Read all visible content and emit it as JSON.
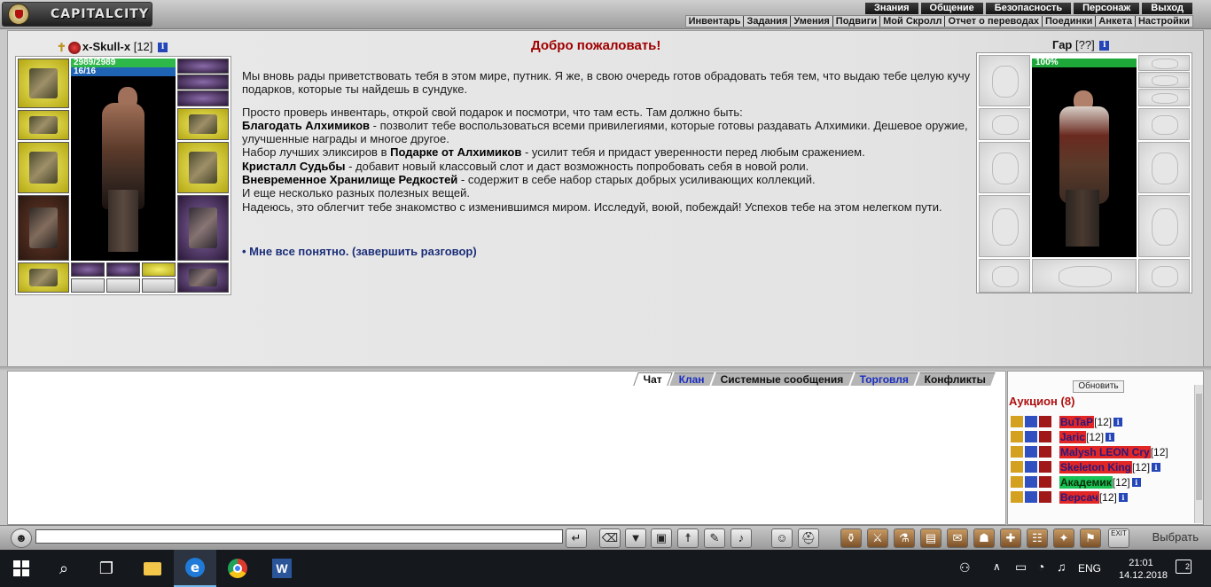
{
  "app": {
    "logo_text": "CAPITALCITY"
  },
  "top_nav": [
    "Знания",
    "Общение",
    "Безопасность",
    "Персонаж",
    "Выход"
  ],
  "sub_nav": [
    "Инвентарь",
    "Задания",
    "Умения",
    "Подвиги",
    "Мой Скролл",
    "Отчет о переводах",
    "Поединки",
    "Анкета",
    "Настройки"
  ],
  "player": {
    "name": "x-Skull-x",
    "level": "[12]",
    "hp": "2989/2989",
    "mana": "16/16"
  },
  "npc": {
    "name": "Гар",
    "level": "[??]",
    "hp": "100%"
  },
  "dialog": {
    "title": "Добро пожаловать!",
    "p1": "Мы вновь рады приветствовать тебя в этом мире, путник. Я же, в свою очередь готов обрадовать тебя тем, что выдаю тебе целую кучу подарков, которые ты найдешь в сундуке.",
    "p2": "Просто проверь инвентарь, открой свой подарок и посмотри, что там есть. Там должно быть:",
    "item1_bold": "Благодать Алхимиков",
    "item1_text": " - позволит тебе воспользоваться всеми привилегиями, которые готовы раздавать Алхимики. Дешевое оружие, улучшенные награды и многое другое.",
    "item2_pre": "Набор лучших эликсиров в ",
    "item2_bold": "Подарке от Алхимиков",
    "item2_text": " - усилит тебя и придаст уверенности перед любым сражением.",
    "item3_bold": "Кристалл Судьбы",
    "item3_text": " - добавит новый классовый слот и даст возможность попробовать себя в новой роли.",
    "item4_bold": "Вневременное Хранилище Редкостей",
    "item4_text": " - содержит в себе набор старых добрых усиливающих коллекций.",
    "item5_text": "И еще несколько разных полезных вещей.",
    "p3": "Надеюсь, это облегчит тебе знакомство с изменившимся миром. Исследуй, воюй, побеждай! Успехов тебе на этом нелегком пути.",
    "link": "• Мне все понятно. (завершить разговор)"
  },
  "chat_tabs": [
    {
      "label": "Чат",
      "active": true,
      "blue": false
    },
    {
      "label": "Клан",
      "active": false,
      "blue": true
    },
    {
      "label": "Системные сообщения",
      "active": false,
      "blue": false
    },
    {
      "label": "Торговля",
      "active": false,
      "blue": true
    },
    {
      "label": "Конфликты",
      "active": false,
      "blue": false
    }
  ],
  "aside": {
    "refresh": "Обновить",
    "title": "Аукцион (8)",
    "players": [
      {
        "name": "BuTaP",
        "level": "[12]",
        "color": "red"
      },
      {
        "name": "Jaric",
        "level": "[12]",
        "color": "red"
      },
      {
        "name": "Malysh LEON Cry",
        "level": "[12]",
        "color": "red"
      },
      {
        "name": "Skeleton King",
        "level": "[12]",
        "color": "red"
      },
      {
        "name": "Академик",
        "level": "[12]",
        "color": "green"
      },
      {
        "name": "Версач",
        "level": "[12]",
        "color": "red"
      }
    ]
  },
  "toolbar": {
    "select": "Выбрать",
    "exit": "EXIT"
  },
  "taskbar": {
    "lang": "ENG",
    "time": "21:01",
    "date": "14.12.2018",
    "notifications": "2"
  }
}
